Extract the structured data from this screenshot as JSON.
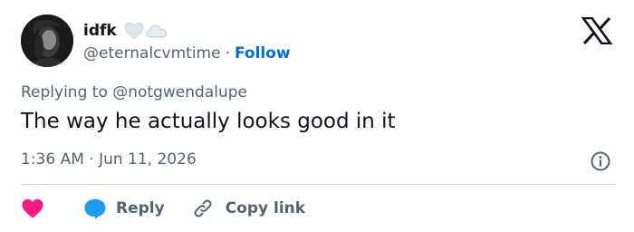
{
  "author": {
    "display_name": "idfk",
    "handle": "@eternalcvmtime",
    "separator": "·",
    "follow_label": "Follow",
    "name_emojis": [
      "white-heart-icon",
      "cloud-icon"
    ]
  },
  "reply_context": {
    "prefix": "Replying to ",
    "mention": "@notgwendalupe"
  },
  "tweet": {
    "text": "The way he actually looks good in it",
    "timestamp": "1:36 AM · Jun 11, 2026"
  },
  "actions": {
    "like_icon": "heart-icon",
    "reply_label": "Reply",
    "copy_link_label": "Copy link"
  },
  "colors": {
    "like": "#f91880",
    "reply": "#1d9bf0",
    "follow": "#006fd6",
    "secondary_text": "#536471",
    "primary_text": "#0f1419"
  }
}
